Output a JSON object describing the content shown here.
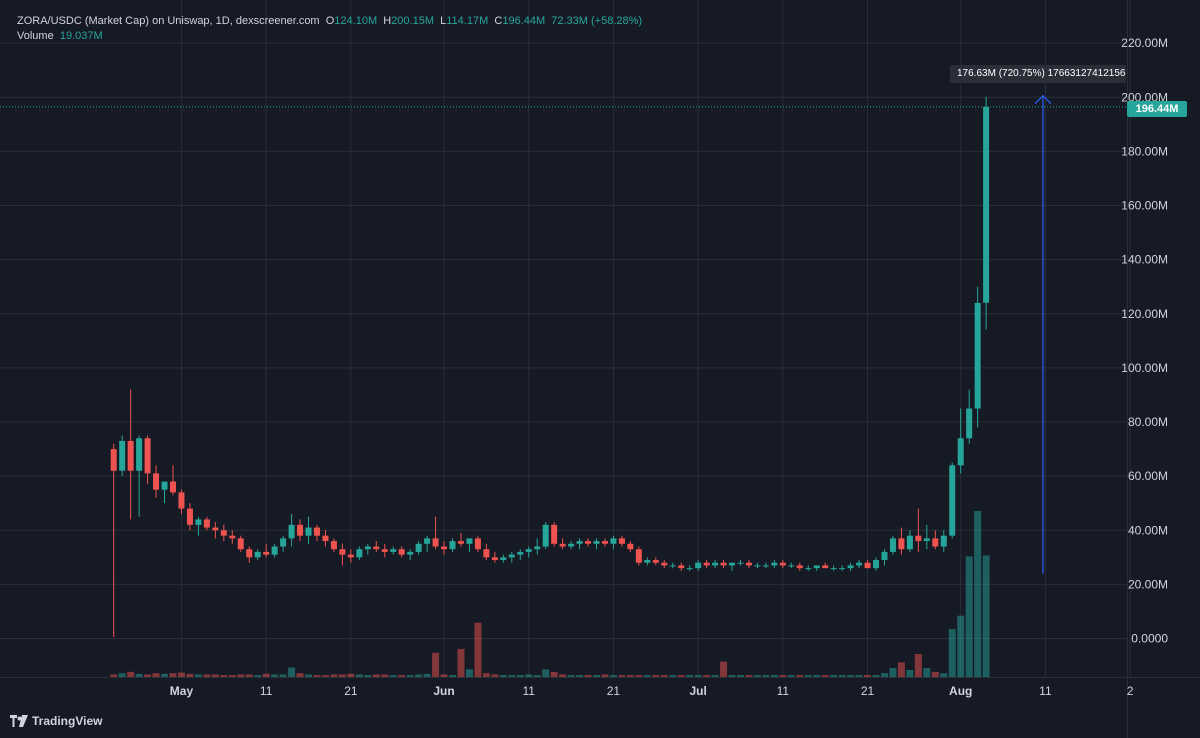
{
  "legend": {
    "symbol": "ZORA/USDC (Market Cap) on Uniswap, 1D, dexscreener.com",
    "o_label": "O",
    "o_value": "124.10M",
    "h_label": "H",
    "h_value": "200.15M",
    "l_label": "L",
    "l_value": "114.17M",
    "c_label": "C",
    "c_value": "196.44M",
    "change": "72.33M (+58.28%)",
    "volume_label": "Volume",
    "volume_value": "19.037M"
  },
  "measure_tool": {
    "label": "176.63M (720.75%) 17663127412156"
  },
  "last_price": "196.44M",
  "brand": "TradingView",
  "colors": {
    "background": "#161a25",
    "up": "#26a69a",
    "down": "#ef5350",
    "grid": "#2a2e39",
    "measure_arrow": "#2962ff"
  },
  "chart_data": {
    "type": "candlestick",
    "y_unit": "market cap (USD)",
    "ylim": [
      -15000000,
      225000000
    ],
    "y_ticks": [
      "220.00M",
      "200.00M",
      "180.00M",
      "160.00M",
      "140.00M",
      "120.00M",
      "100.00M",
      "80.00M",
      "60.00M",
      "40.00M",
      "20.00M",
      "0.0000"
    ],
    "x_ticks": [
      "May",
      "11",
      "21",
      "Jun",
      "11",
      "21",
      "Jul",
      "11",
      "21",
      "Aug",
      "11",
      "2"
    ],
    "x_tick_dates": [
      "2025-05-01",
      "2025-05-11",
      "2025-05-21",
      "2025-06-01",
      "2025-06-11",
      "2025-06-21",
      "2025-07-01",
      "2025-07-11",
      "2025-07-21",
      "2025-08-01",
      "2025-08-11",
      "2025-08-21"
    ],
    "grid": true,
    "candle_start_date": "2025-04-23",
    "candles": [
      [
        70,
        72,
        0.5,
        62
      ],
      [
        62,
        75,
        60,
        73
      ],
      [
        73,
        92,
        44,
        62
      ],
      [
        62,
        75,
        45,
        74
      ],
      [
        74,
        75,
        57,
        61
      ],
      [
        61,
        64,
        52,
        55
      ],
      [
        55,
        58,
        50,
        58
      ],
      [
        58,
        64,
        53,
        54
      ],
      [
        54,
        55,
        46,
        48
      ],
      [
        48,
        50,
        40,
        42
      ],
      [
        42,
        45,
        38,
        44
      ],
      [
        44,
        45,
        40,
        41
      ],
      [
        41,
        43,
        37,
        40
      ],
      [
        40,
        42,
        36,
        38
      ],
      [
        38,
        40,
        35,
        37
      ],
      [
        37,
        38,
        32,
        33
      ],
      [
        33,
        34,
        28,
        30
      ],
      [
        30,
        33,
        29,
        32
      ],
      [
        32,
        35,
        30,
        31
      ],
      [
        31,
        35,
        30,
        34
      ],
      [
        34,
        38,
        32,
        37
      ],
      [
        37,
        46,
        34,
        42
      ],
      [
        42,
        44,
        36,
        38
      ],
      [
        38,
        45,
        35,
        41
      ],
      [
        41,
        42,
        36,
        38
      ],
      [
        38,
        40,
        34,
        36
      ],
      [
        36,
        37,
        32,
        33
      ],
      [
        33,
        35,
        27,
        31
      ],
      [
        31,
        33,
        28,
        30
      ],
      [
        30,
        34,
        29,
        33
      ],
      [
        33,
        35,
        31,
        34
      ],
      [
        34,
        36,
        32,
        33
      ],
      [
        33,
        35,
        30,
        32
      ],
      [
        32,
        34,
        31,
        33
      ],
      [
        33,
        34,
        30,
        31
      ],
      [
        31,
        33,
        29,
        32
      ],
      [
        32,
        36,
        31,
        35
      ],
      [
        35,
        38,
        32,
        37
      ],
      [
        37,
        45,
        33,
        34
      ],
      [
        34,
        36,
        31,
        33
      ],
      [
        33,
        37,
        32,
        36
      ],
      [
        36,
        39,
        34,
        35
      ],
      [
        35,
        37,
        32,
        37
      ],
      [
        37,
        38,
        32,
        33
      ],
      [
        33,
        35,
        29,
        30
      ],
      [
        30,
        32,
        28,
        29
      ],
      [
        29,
        31,
        28,
        30
      ],
      [
        30,
        32,
        28,
        31
      ],
      [
        31,
        33,
        29,
        32
      ],
      [
        32,
        34,
        30,
        33
      ],
      [
        33,
        37,
        31,
        34
      ],
      [
        34,
        43,
        33,
        42
      ],
      [
        42,
        43,
        34,
        35
      ],
      [
        35,
        37,
        33,
        34
      ],
      [
        34,
        36,
        33,
        35
      ],
      [
        35,
        37,
        33,
        36
      ],
      [
        36,
        37,
        34,
        35
      ],
      [
        35,
        37,
        33,
        36
      ],
      [
        36,
        37,
        34,
        35
      ],
      [
        35,
        38,
        33,
        37
      ],
      [
        37,
        38,
        34,
        35
      ],
      [
        35,
        36,
        32,
        33
      ],
      [
        33,
        34,
        27,
        28
      ],
      [
        28,
        30,
        27,
        29
      ],
      [
        29,
        30,
        27,
        28
      ],
      [
        28,
        29,
        26,
        27
      ],
      [
        27,
        28,
        26,
        27
      ],
      [
        27,
        28,
        25,
        26
      ],
      [
        26,
        27,
        25,
        26
      ],
      [
        26,
        29,
        25,
        28
      ],
      [
        28,
        29,
        26,
        27
      ],
      [
        27,
        29,
        26,
        28
      ],
      [
        28,
        29,
        26,
        27
      ],
      [
        27,
        28,
        25,
        28
      ],
      [
        28,
        29,
        27,
        28
      ],
      [
        28,
        29,
        26,
        27
      ],
      [
        27,
        28,
        26,
        27
      ],
      [
        27,
        28,
        26,
        27
      ],
      [
        27,
        29,
        26,
        28
      ],
      [
        28,
        29,
        26,
        27
      ],
      [
        27,
        28,
        26,
        27
      ],
      [
        27,
        28,
        25,
        26
      ],
      [
        26,
        27,
        25,
        26
      ],
      [
        26,
        27,
        25,
        27
      ],
      [
        27,
        28,
        26,
        26
      ],
      [
        26,
        27,
        25,
        26
      ],
      [
        26,
        27,
        25,
        26
      ],
      [
        26,
        28,
        25,
        27
      ],
      [
        27,
        29,
        26,
        28
      ],
      [
        28,
        29,
        26,
        26
      ],
      [
        26,
        30,
        25,
        29
      ],
      [
        29,
        33,
        27,
        32
      ],
      [
        32,
        38,
        31,
        37
      ],
      [
        37,
        41,
        31,
        33
      ],
      [
        33,
        40,
        32,
        38
      ],
      [
        38,
        48,
        32,
        36
      ],
      [
        36,
        42,
        33,
        37
      ],
      [
        37,
        40,
        33,
        34
      ],
      [
        34,
        40,
        32,
        38
      ],
      [
        38,
        65,
        37,
        64
      ],
      [
        64,
        85,
        61,
        74
      ],
      [
        74,
        92,
        72,
        85
      ],
      [
        85,
        130,
        78,
        124
      ],
      [
        124.1,
        200.15,
        114.17,
        196.44
      ]
    ],
    "volume_scale_M": 19.037,
    "volume_relative": [
      0.4,
      0.6,
      0.8,
      0.5,
      0.4,
      0.6,
      0.5,
      0.6,
      0.7,
      0.5,
      0.4,
      0.4,
      0.4,
      0.3,
      0.3,
      0.4,
      0.4,
      0.3,
      0.5,
      0.4,
      0.4,
      1.5,
      0.6,
      0.4,
      0.3,
      0.3,
      0.4,
      0.4,
      0.5,
      0.4,
      0.3,
      0.4,
      0.4,
      0.3,
      0.3,
      0.3,
      0.4,
      0.5,
      3.8,
      0.4,
      0.3,
      4.4,
      1.2,
      8.5,
      0.6,
      0.4,
      0.3,
      0.3,
      0.3,
      0.4,
      0.3,
      1.2,
      0.8,
      0.4,
      0.3,
      0.3,
      0.3,
      0.3,
      0.4,
      0.3,
      0.3,
      0.3,
      0.3,
      0.3,
      0.3,
      0.3,
      0.3,
      0.3,
      0.3,
      0.3,
      0.3,
      0.3,
      2.4,
      0.3,
      0.3,
      0.3,
      0.3,
      0.3,
      0.3,
      0.3,
      0.3,
      0.3,
      0.3,
      0.3,
      0.3,
      0.3,
      0.3,
      0.3,
      0.3,
      0.3,
      0.3,
      0.6,
      1.4,
      2.3,
      1.1,
      3.6,
      1.4,
      0.8,
      0.6,
      7.5,
      9.6,
      18.9,
      26.0,
      19.037
    ],
    "measure": {
      "from": 23.95,
      "to": 200.58
    }
  }
}
